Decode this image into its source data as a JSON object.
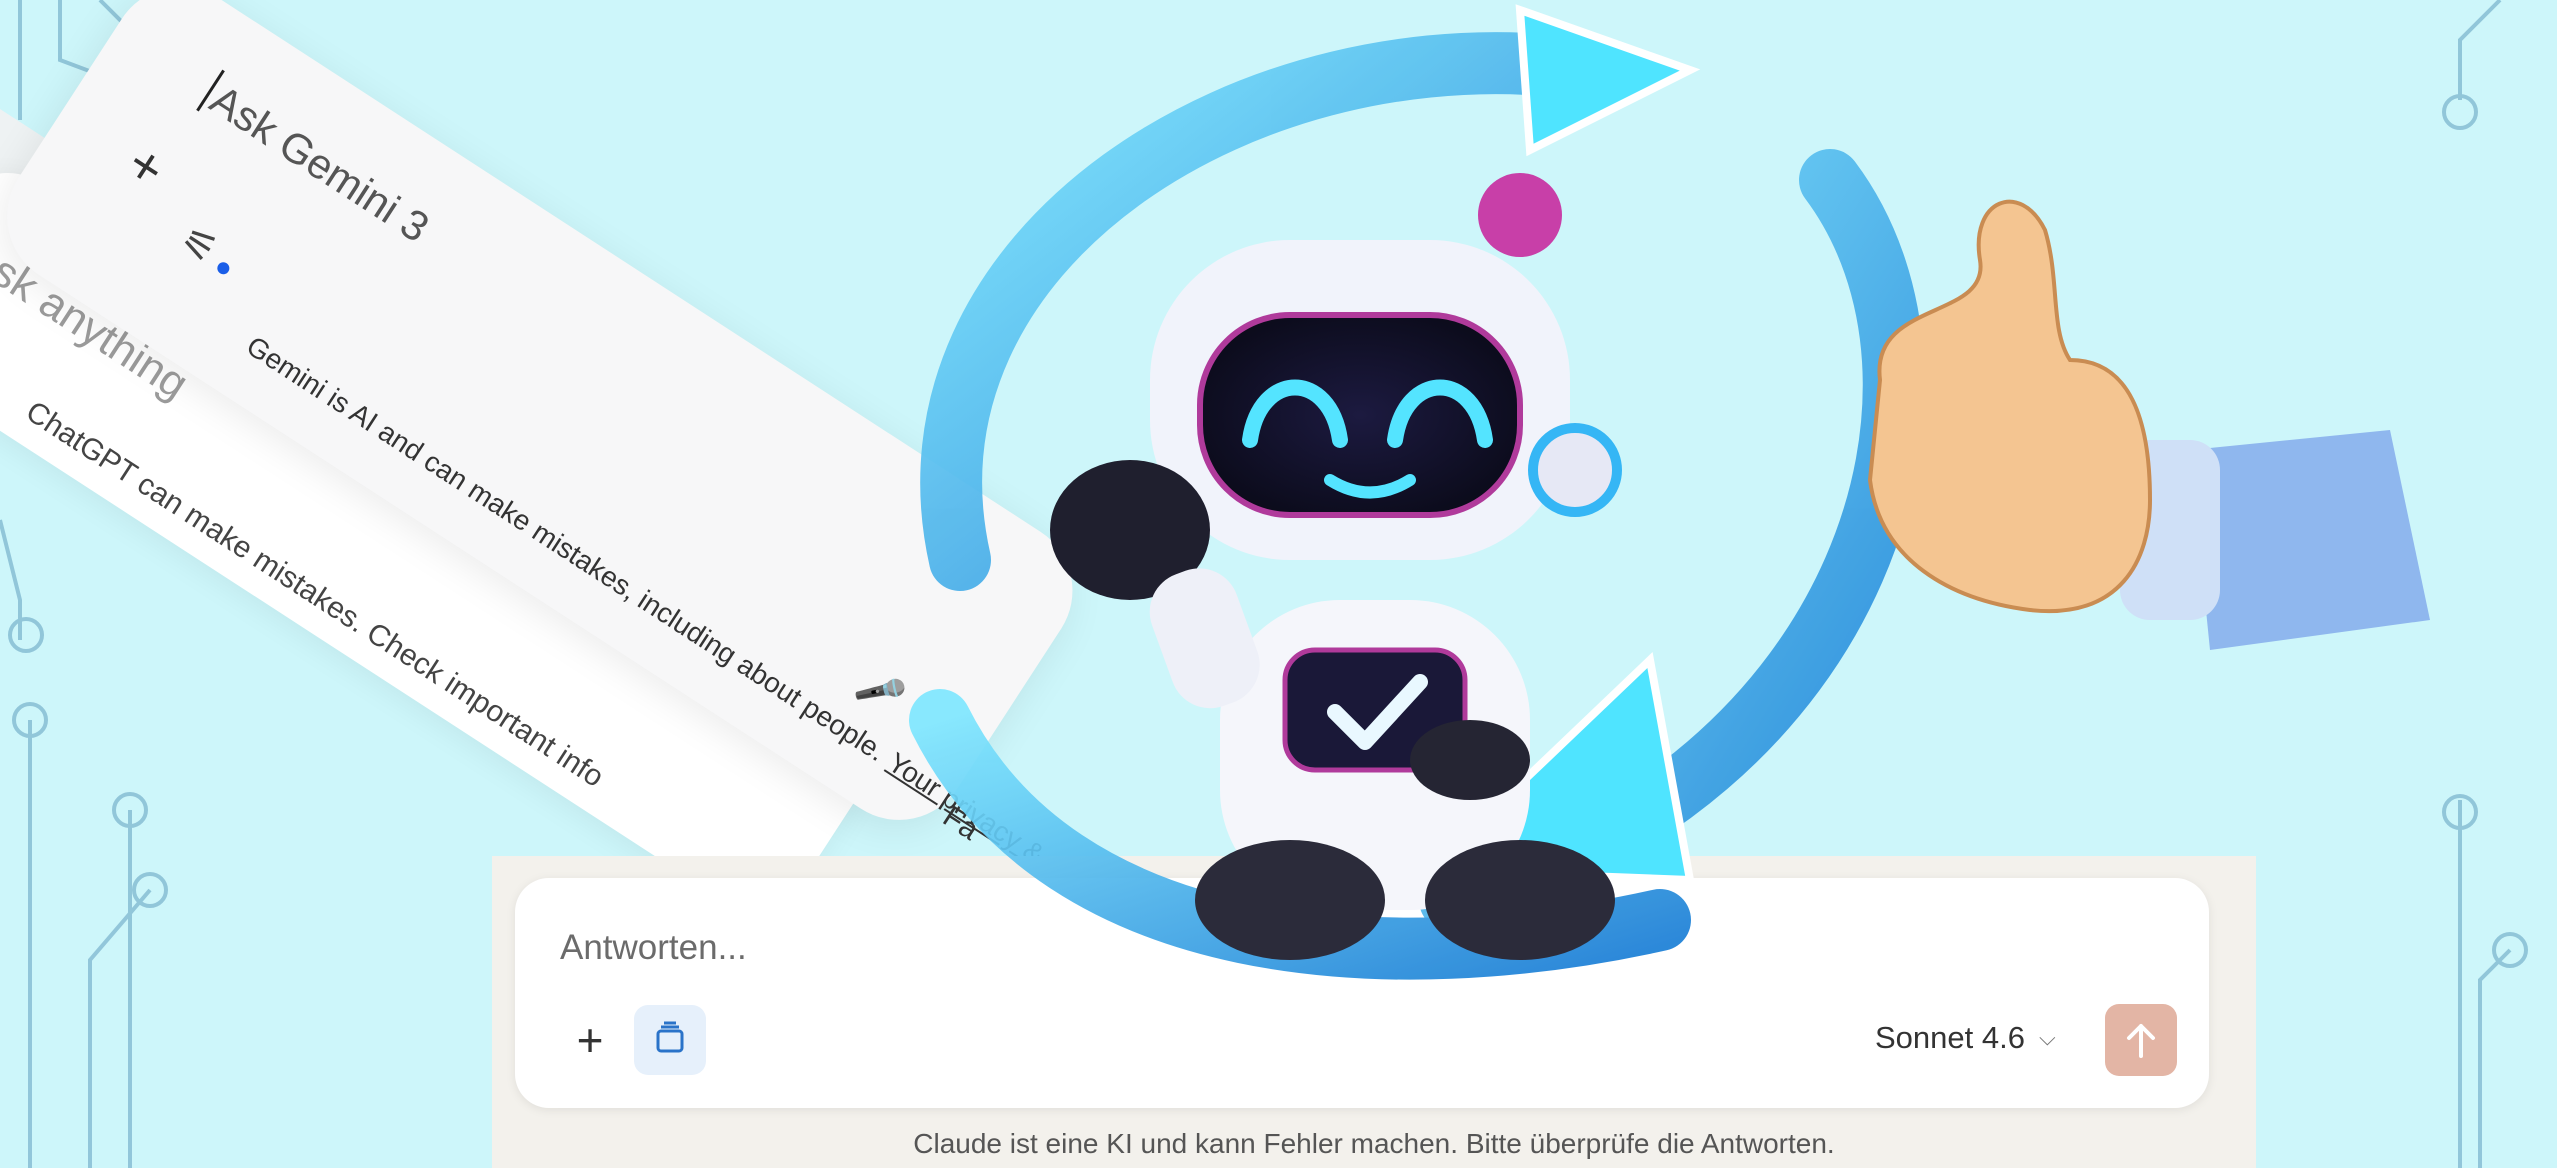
{
  "gemini": {
    "placeholder": "Ask Gemini 3",
    "disclaimer": "Gemini is AI and can make mistakes, including about people.",
    "privacy_link": "Your privacy & Gemini"
  },
  "chatgpt": {
    "placeholder": "Ask anything",
    "disclaimer": "ChatGPT can make mistakes. Check important info"
  },
  "claude": {
    "placeholder": "Antworten...",
    "model": "Sonnet 4.6",
    "disclaimer": "Claude ist eine KI und kann Fehler machen. Bitte überprüfe die Antworten."
  },
  "icons": {
    "plus": "+",
    "tune": "⚟",
    "mic": "🎤",
    "chevron": "⌵"
  },
  "colors": {
    "background": "#cdf6fa",
    "claude_send": "#e3b5a5",
    "claude_tool": "#e6f0fb",
    "gemini_dot": "#1a5ee8"
  },
  "overlay_text": "Fa"
}
